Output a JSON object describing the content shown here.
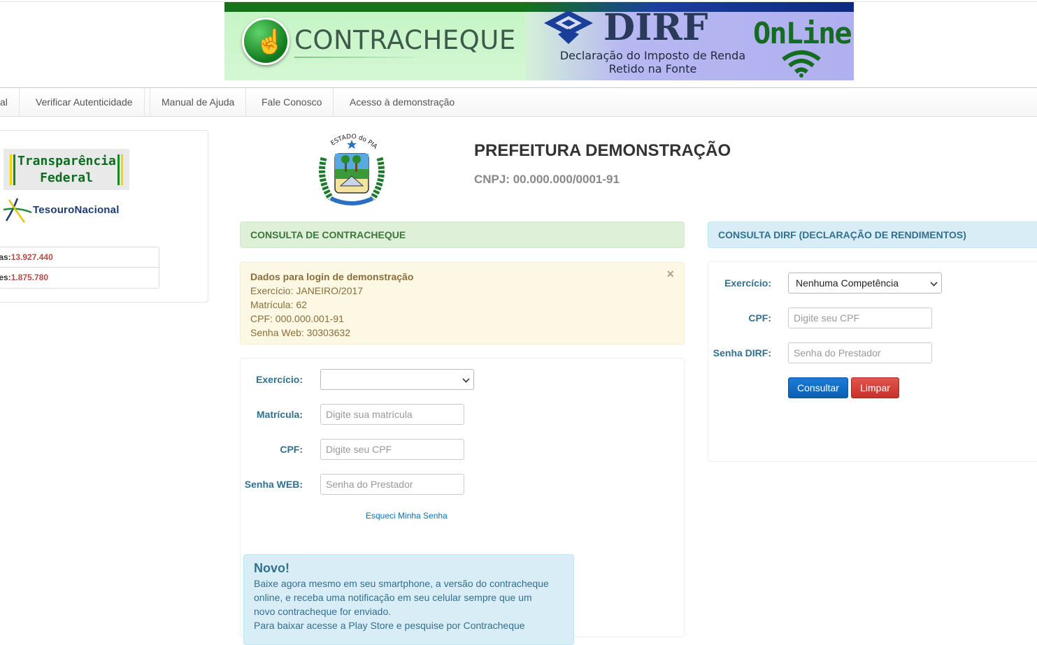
{
  "banner": {
    "contracheque_title": "CONTRACHEQUE",
    "dirf_title": "DIRF",
    "dirf_subtitle_line1": "Declaração do Imposto de Renda",
    "dirf_subtitle_line2": "Retido na Fonte",
    "online_title": "OnLine"
  },
  "nav": {
    "items": [
      "al",
      "Verificar Autenticidade",
      "Manual de Ajuda",
      "Fale Conosco",
      "Acesso à demonstração"
    ]
  },
  "sidebar": {
    "transparencia_line1": "Transparência",
    "transparencia_line2": "Federal",
    "tesouro_label": "TesouroNacional",
    "stats": [
      {
        "label": "itas: ",
        "value": "13.927.440"
      },
      {
        "label": "ues: ",
        "value": "1.875.780"
      }
    ]
  },
  "header": {
    "coat_caption": "ESTADO do PIAUÍ",
    "title": "PREFEITURA DEMONSTRAÇÃO",
    "cnpj": "CNPJ: 00.000.000/0001-91"
  },
  "contracheque": {
    "heading": "CONSULTA DE CONTRACHEQUE",
    "alert": {
      "title": "Dados para login de demonstração",
      "line1": "Exercício: JANEIRO/2017",
      "line2": "Matrícula: 62",
      "line3": "CPF: 000.000.001-91",
      "line4": "Senha Web: 30303632",
      "close": "×"
    },
    "form": {
      "exercicio_label": "Exercício:",
      "exercicio_value": "",
      "matricula_label": "Matrícula:",
      "matricula_placeholder": "Digite sua matrícula",
      "cpf_label": "CPF:",
      "cpf_placeholder": "Digite seu CPF",
      "senha_label": "Senha WEB:",
      "senha_placeholder": "Senha do Prestador",
      "forgot_link": "Esqueci Minha Senha"
    },
    "novo": {
      "title": "Novo!",
      "line1": "Baixe agora mesmo em seu smartphone, a versão do contracheque",
      "line2": "online, e receba uma notificação em seu celular sempre que um",
      "line3": "novo contracheque for enviado.",
      "line4": "Para baixar acesse a Play Store e pesquise por Contracheque"
    }
  },
  "dirf": {
    "heading": "CONSULTA DIRF (DECLARAÇÃO DE RENDIMENTOS)",
    "form": {
      "exercicio_label": "Exercício:",
      "exercicio_value": "Nenhuma Competência",
      "cpf_label": "CPF:",
      "cpf_placeholder": "Digite seu CPF",
      "senha_label": "Senha DIRF:",
      "senha_placeholder": "Senha do Prestador",
      "consultar": "Consultar",
      "limpar": "Limpar"
    }
  },
  "colors": {
    "accent_blue": "#31708f",
    "success_green": "#3c763d",
    "warning_text": "#8a6d3b",
    "danger": "#c9302c",
    "primary": "#0d5fb3"
  }
}
